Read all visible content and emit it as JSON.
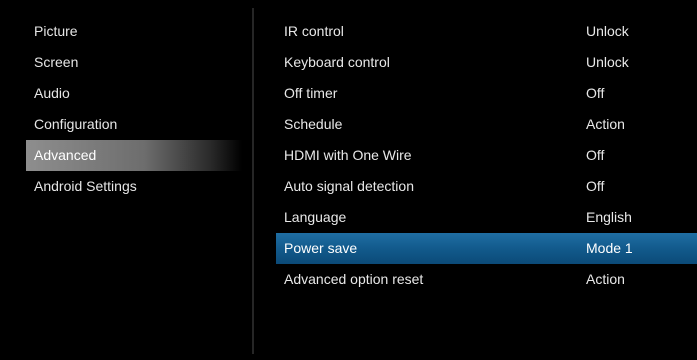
{
  "left_menu": {
    "items": [
      {
        "label": "Picture"
      },
      {
        "label": "Screen"
      },
      {
        "label": "Audio"
      },
      {
        "label": "Configuration"
      },
      {
        "label": "Advanced"
      },
      {
        "label": "Android Settings"
      }
    ],
    "active_index": 4
  },
  "settings": {
    "rows": [
      {
        "label": "IR control",
        "value": "Unlock"
      },
      {
        "label": "Keyboard control",
        "value": "Unlock"
      },
      {
        "label": "Off timer",
        "value": "Off"
      },
      {
        "label": "Schedule",
        "value": "Action"
      },
      {
        "label": "HDMI with One Wire",
        "value": "Off"
      },
      {
        "label": "Auto signal detection",
        "value": "Off"
      },
      {
        "label": "Language",
        "value": "English"
      },
      {
        "label": "Power save",
        "value": "Mode 1"
      },
      {
        "label": "Advanced option reset",
        "value": "Action"
      }
    ],
    "selected_index": 7
  },
  "colors": {
    "background": "#000000",
    "selection_blue": "#125a8c",
    "active_gray": "#7a7a7a",
    "text": "#e8e8e8"
  }
}
